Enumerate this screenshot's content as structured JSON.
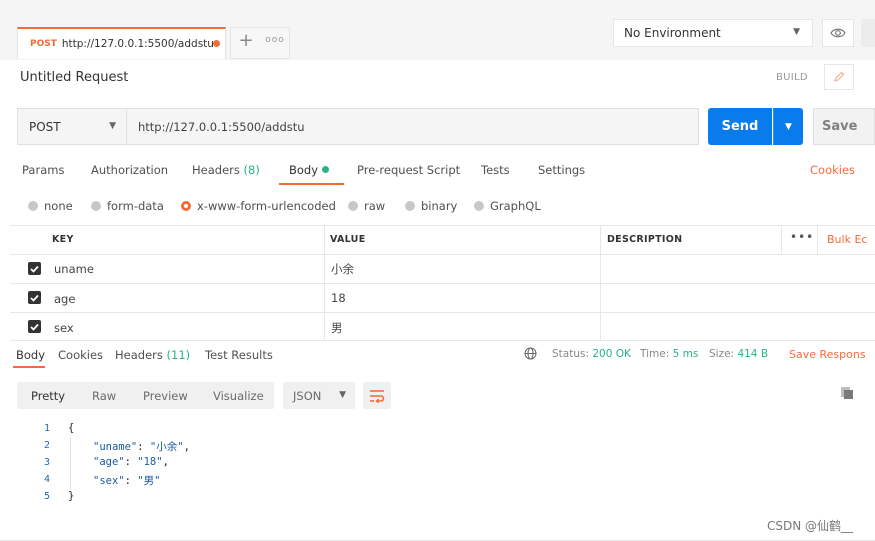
{
  "tab": {
    "method": "POST",
    "url": "http://127.0.0.1:5500/addstu",
    "add": "+",
    "more": "ooo"
  },
  "environment": {
    "selected": "No Environment"
  },
  "request": {
    "title": "Untitled Request",
    "build_label": "BUILD",
    "method": "POST",
    "url": "http://127.0.0.1:5500/addstu",
    "send_label": "Send",
    "save_label": "Save"
  },
  "req_tabs": {
    "params": "Params",
    "authorization": "Authorization",
    "headers": "Headers",
    "headers_count": "(8)",
    "body": "Body",
    "prerequest": "Pre-request Script",
    "tests": "Tests",
    "settings": "Settings",
    "cookies": "Cookies"
  },
  "body_types": [
    "none",
    "form-data",
    "x-www-form-urlencoded",
    "raw",
    "binary",
    "GraphQL"
  ],
  "table": {
    "headers": {
      "key": "KEY",
      "value": "VALUE",
      "description": "DESCRIPTION",
      "more": "•••",
      "bulk": "Bulk Ec"
    },
    "rows": [
      {
        "key": "uname",
        "value": "小余",
        "description": ""
      },
      {
        "key": "age",
        "value": "18",
        "description": ""
      },
      {
        "key": "sex",
        "value": "男",
        "description": ""
      }
    ]
  },
  "response": {
    "tabs": {
      "body": "Body",
      "cookies": "Cookies",
      "headers": "Headers",
      "headers_count": "(11)",
      "test_results": "Test Results"
    },
    "status_label": "Status:",
    "status_value": "200 OK",
    "time_label": "Time:",
    "time_value": "5 ms",
    "size_label": "Size:",
    "size_value": "414 B",
    "save_label": "Save Respons",
    "formats": {
      "pretty": "Pretty",
      "raw": "Raw",
      "preview": "Preview",
      "visualize": "Visualize"
    },
    "language": "JSON",
    "lines": [
      "1",
      "2",
      "3",
      "4",
      "5"
    ],
    "json": {
      "open": "{",
      "k1": "\"uname\"",
      "v1": "\"小余\"",
      "k2": "\"age\"",
      "v2": "\"18\"",
      "k3": "\"sex\"",
      "v3": "\"男\"",
      "close": "}"
    }
  },
  "watermark": "CSDN @仙鹤__",
  "colors": {
    "accent": "#f26b3a",
    "send": "#097bed",
    "success": "#26b47f"
  }
}
